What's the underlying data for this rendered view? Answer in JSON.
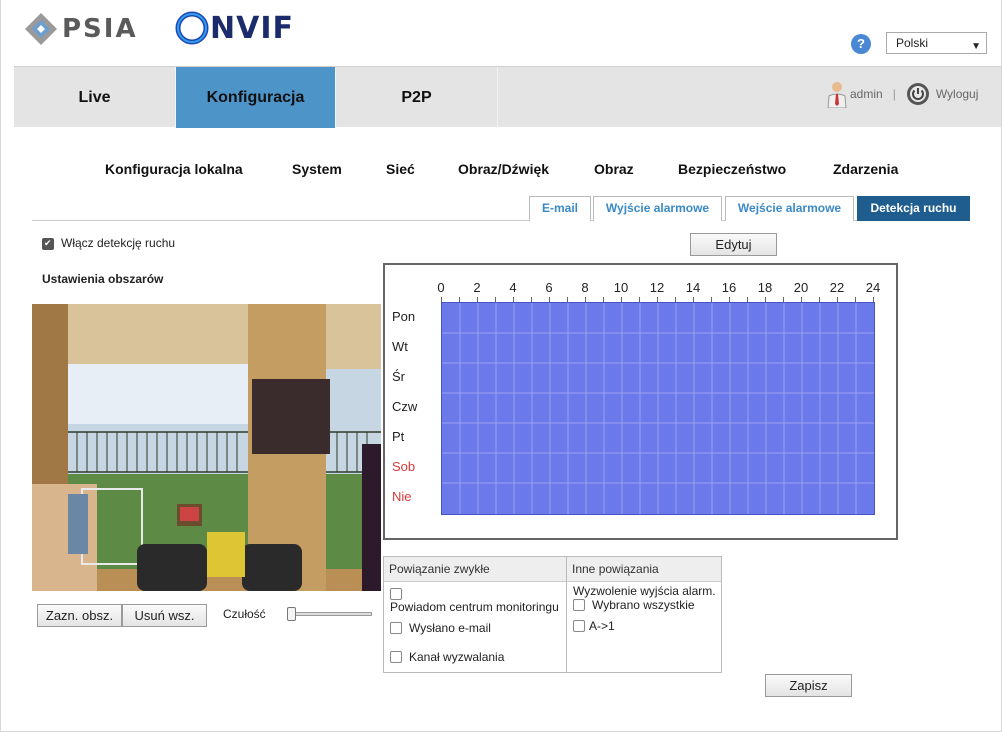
{
  "header": {
    "psia_logo": "PSIA",
    "onvif_logo": "NVIF",
    "help": "?",
    "language": "Polski"
  },
  "nav": {
    "tabs": [
      "Live",
      "Konfiguracja",
      "P2P"
    ],
    "active": "Konfiguracja",
    "user": "admin",
    "separator": "|",
    "logout": "Wyloguj"
  },
  "subnav": [
    "Konfiguracja lokalna",
    "System",
    "Sieć",
    "Obraz/Dźwięk",
    "Obraz",
    "Bezpieczeństwo",
    "Zdarzenia"
  ],
  "tabs": [
    "E-mail",
    "Wyjście alarmowe",
    "Wejście alarmowe",
    "Detekcja ruchu"
  ],
  "active_tab": "Detekcja ruchu",
  "motion": {
    "enable_label": "Włącz detekcję ruchu",
    "enabled": true,
    "area_settings": "Ustawienia obszarów",
    "edit_button": "Edytuj",
    "draw_area_button": "Zazn. obsz.",
    "clear_all_button": "Usuń wsz.",
    "sensitivity_label": "Czułość",
    "sensitivity": 0
  },
  "schedule": {
    "hours": [
      "0",
      "2",
      "4",
      "6",
      "8",
      "10",
      "12",
      "14",
      "16",
      "18",
      "20",
      "22",
      "24"
    ],
    "days": [
      "Pon",
      "Wt",
      "Śr",
      "Czw",
      "Pt",
      "Sob",
      "Nie"
    ],
    "weekend_color": "#d83a3a",
    "fill_color": "#6c79ea"
  },
  "linkage": {
    "normal_header": "Powiązanie zwykłe",
    "other_header": "Inne powiązania",
    "notify_center": "Powiadom centrum monitoringu",
    "send_email": "Wysłano e-mail",
    "trigger_channel": "Kanał wyzwalania",
    "trigger_output": "Wyzwolenie wyjścia alarm.",
    "select_all": "Wybrano wszystkie",
    "output_a1": "A->1"
  },
  "save_button": "Zapisz"
}
